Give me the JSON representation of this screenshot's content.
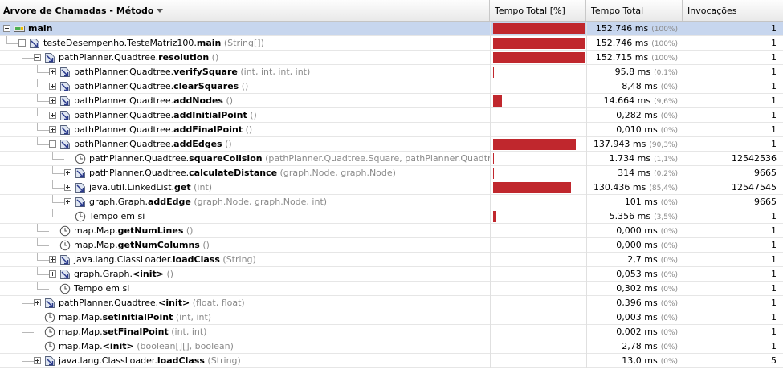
{
  "header": {
    "col_tree": "Árvore de Chamadas - Método",
    "col_pct": "Tempo Total [%]",
    "col_time": "Tempo Total",
    "col_inv": "Invocações"
  },
  "colors": {
    "bar": "#c0272d",
    "selection": "#c7d6ee"
  },
  "rows": [
    {
      "depth": 0,
      "exp": "minus",
      "icon": "thread-icon",
      "prefix": "",
      "name": "main",
      "sig": "",
      "time": "152.746 ms",
      "pct": "(100%)",
      "bar": 1.0,
      "inv": "1",
      "selected": true
    },
    {
      "depth": 1,
      "exp": "minus",
      "icon": "method-icon",
      "prefix": "testeDesempenho.TesteMatriz100.",
      "name": "main",
      "sig": "(String[])",
      "time": "152.746 ms",
      "pct": "(100%)",
      "bar": 1.0,
      "inv": "1"
    },
    {
      "depth": 2,
      "exp": "minus",
      "icon": "method-icon",
      "prefix": "pathPlanner.Quadtree.",
      "name": "resolution",
      "sig": "()",
      "time": "152.715 ms",
      "pct": "(100%)",
      "bar": 1.0,
      "inv": "1"
    },
    {
      "depth": 3,
      "exp": "plus",
      "icon": "method-icon",
      "prefix": "pathPlanner.Quadtree.",
      "name": "verifySquare",
      "sig": "(int, int, int, int)",
      "time": "95,8 ms",
      "pct": "(0,1%)",
      "bar": 0.001,
      "inv": "1"
    },
    {
      "depth": 3,
      "exp": "plus",
      "icon": "method-icon",
      "prefix": "pathPlanner.Quadtree.",
      "name": "clearSquares",
      "sig": "()",
      "time": "8,48 ms",
      "pct": "(0%)",
      "bar": 0,
      "inv": "1"
    },
    {
      "depth": 3,
      "exp": "plus",
      "icon": "method-icon",
      "prefix": "pathPlanner.Quadtree.",
      "name": "addNodes",
      "sig": "()",
      "time": "14.664 ms",
      "pct": "(9,6%)",
      "bar": 0.096,
      "inv": "1"
    },
    {
      "depth": 3,
      "exp": "plus",
      "icon": "method-icon",
      "prefix": "pathPlanner.Quadtree.",
      "name": "addInitialPoint",
      "sig": "()",
      "time": "0,282 ms",
      "pct": "(0%)",
      "bar": 0,
      "inv": "1"
    },
    {
      "depth": 3,
      "exp": "plus",
      "icon": "method-icon",
      "prefix": "pathPlanner.Quadtree.",
      "name": "addFinalPoint",
      "sig": "()",
      "time": "0,010 ms",
      "pct": "(0%)",
      "bar": 0,
      "inv": "1"
    },
    {
      "depth": 3,
      "exp": "minus",
      "icon": "method-icon",
      "prefix": "pathPlanner.Quadtree.",
      "name": "addEdges",
      "sig": "()",
      "time": "137.943 ms",
      "pct": "(90,3%)",
      "bar": 0.903,
      "inv": "1"
    },
    {
      "depth": 4,
      "exp": "",
      "icon": "clock-icon",
      "prefix": "pathPlanner.Quadtree.",
      "name": "squareColision",
      "sig": "(pathPlanner.Quadtree.Square, pathPlanner.Quadtree.Square)",
      "time": "1.734 ms",
      "pct": "(1,1%)",
      "bar": 0.011,
      "inv": "12542536"
    },
    {
      "depth": 4,
      "exp": "plus",
      "icon": "method-icon",
      "prefix": "pathPlanner.Quadtree.",
      "name": "calculateDistance",
      "sig": "(graph.Node, graph.Node)",
      "time": "314 ms",
      "pct": "(0,2%)",
      "bar": 0.002,
      "inv": "9665"
    },
    {
      "depth": 4,
      "exp": "plus",
      "icon": "method-icon",
      "prefix": "java.util.LinkedList.",
      "name": "get",
      "sig": "(int)",
      "time": "130.436 ms",
      "pct": "(85,4%)",
      "bar": 0.854,
      "inv": "12547545"
    },
    {
      "depth": 4,
      "exp": "plus",
      "icon": "method-icon",
      "prefix": "graph.Graph.",
      "name": "addEdge",
      "sig": "(graph.Node, graph.Node, int)",
      "time": "101 ms",
      "pct": "(0%)",
      "bar": 0,
      "inv": "9665"
    },
    {
      "depth": 4,
      "exp": "",
      "icon": "clock-icon",
      "prefix": "Tempo em si",
      "name": "",
      "sig": "",
      "time": "5.356 ms",
      "pct": "(3,5%)",
      "bar": 0.035,
      "inv": "1"
    },
    {
      "depth": 3,
      "exp": "",
      "icon": "clock-icon",
      "prefix": "map.Map.",
      "name": "getNumLines",
      "sig": "()",
      "time": "0,000 ms",
      "pct": "(0%)",
      "bar": 0,
      "inv": "1"
    },
    {
      "depth": 3,
      "exp": "",
      "icon": "clock-icon",
      "prefix": "map.Map.",
      "name": "getNumColumns",
      "sig": "()",
      "time": "0,000 ms",
      "pct": "(0%)",
      "bar": 0,
      "inv": "1"
    },
    {
      "depth": 3,
      "exp": "plus",
      "icon": "method-icon",
      "prefix": "java.lang.ClassLoader.",
      "name": "loadClass",
      "sig": "(String)",
      "time": "2,7 ms",
      "pct": "(0%)",
      "bar": 0,
      "inv": "1"
    },
    {
      "depth": 3,
      "exp": "plus",
      "icon": "method-icon",
      "prefix": "graph.Graph.",
      "name": "<init>",
      "sig": "()",
      "time": "0,053 ms",
      "pct": "(0%)",
      "bar": 0,
      "inv": "1"
    },
    {
      "depth": 3,
      "exp": "",
      "icon": "clock-icon",
      "prefix": "Tempo em si",
      "name": "",
      "sig": "",
      "time": "0,302 ms",
      "pct": "(0%)",
      "bar": 0,
      "inv": "1"
    },
    {
      "depth": 2,
      "exp": "plus",
      "icon": "method-icon",
      "prefix": "pathPlanner.Quadtree.",
      "name": "<init>",
      "sig": "(float, float)",
      "time": "0,396 ms",
      "pct": "(0%)",
      "bar": 0,
      "inv": "1"
    },
    {
      "depth": 2,
      "exp": "",
      "icon": "clock-icon",
      "prefix": "map.Map.",
      "name": "setInitialPoint",
      "sig": "(int, int)",
      "time": "0,003 ms",
      "pct": "(0%)",
      "bar": 0,
      "inv": "1"
    },
    {
      "depth": 2,
      "exp": "",
      "icon": "clock-icon",
      "prefix": "map.Map.",
      "name": "setFinalPoint",
      "sig": "(int, int)",
      "time": "0,002 ms",
      "pct": "(0%)",
      "bar": 0,
      "inv": "1"
    },
    {
      "depth": 2,
      "exp": "",
      "icon": "clock-icon",
      "prefix": "map.Map.",
      "name": "<init>",
      "sig": "(boolean[][], boolean)",
      "time": "2,78 ms",
      "pct": "(0%)",
      "bar": 0,
      "inv": "1"
    },
    {
      "depth": 2,
      "exp": "plus",
      "icon": "method-icon",
      "prefix": "java.lang.ClassLoader.",
      "name": "loadClass",
      "sig": "(String)",
      "time": "13,0 ms",
      "pct": "(0%)",
      "bar": 0,
      "inv": "5"
    }
  ]
}
